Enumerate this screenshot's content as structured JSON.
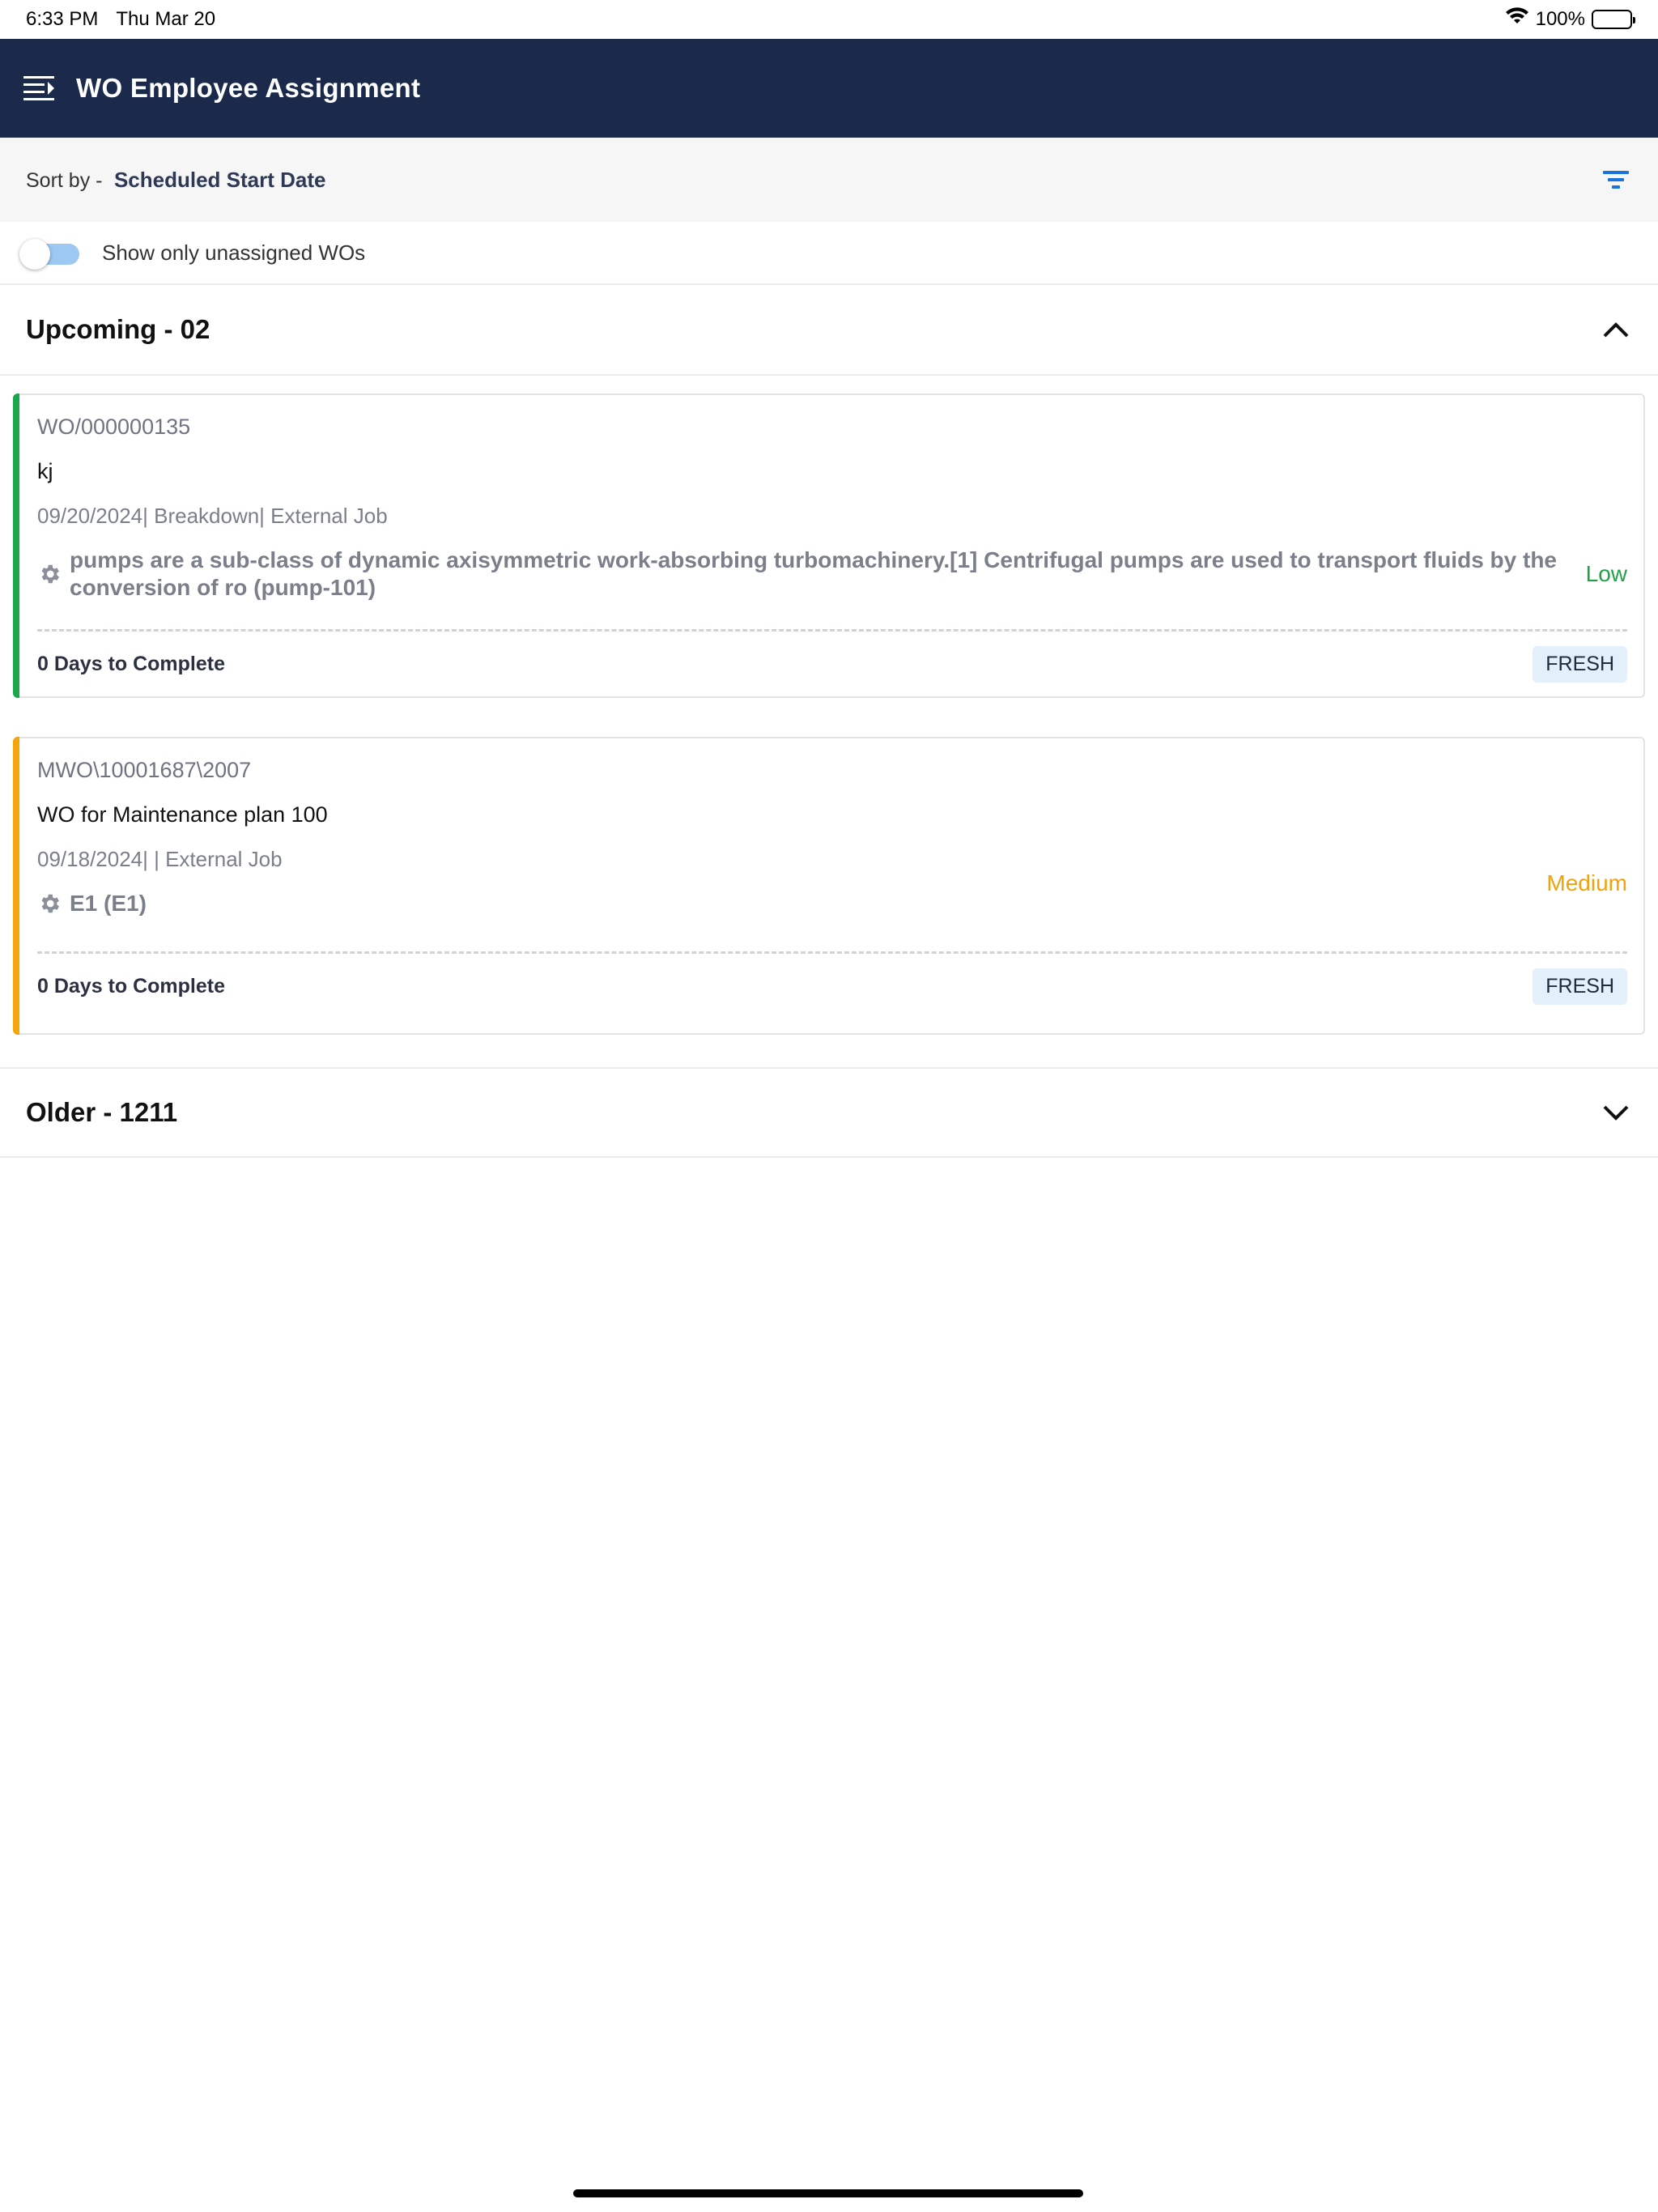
{
  "status_bar": {
    "time": "6:33 PM",
    "date": "Thu Mar 20",
    "battery": "100%"
  },
  "header": {
    "title": "WO Employee Assignment"
  },
  "sort": {
    "label": "Sort by -",
    "value": "Scheduled Start Date"
  },
  "toggle": {
    "label": "Show only unassigned WOs",
    "on": false
  },
  "sections": {
    "upcoming": {
      "title": "Upcoming - 02",
      "expanded": true
    },
    "older": {
      "title": "Older - 1211",
      "expanded": false
    }
  },
  "cards": [
    {
      "number": "WO/000000135",
      "title": "kj",
      "meta": "09/20/2024| Breakdown| External Job",
      "asset": "pumps are a sub-class of dynamic axisymmetric work-absorbing turbomachinery.[1] Centrifugal pumps are used to transport fluids by the conversion of ro (pump-101)",
      "priority": "Low",
      "priority_color": "#21a146",
      "accent_color": "#1aa64a",
      "days": "0 Days to Complete",
      "status": "FRESH"
    },
    {
      "number": "MWO\\10001687\\2007",
      "title": "WO for Maintenance plan 100",
      "meta": "09/18/2024| | External Job",
      "asset": "E1 (E1)",
      "priority": "Medium",
      "priority_color": "#f2a20c",
      "accent_color": "#f5a40b",
      "days": "0 Days to Complete",
      "status": "FRESH"
    }
  ],
  "colors": {
    "header_bg": "#1b2a4a",
    "filter_icon": "#1a73d9"
  }
}
